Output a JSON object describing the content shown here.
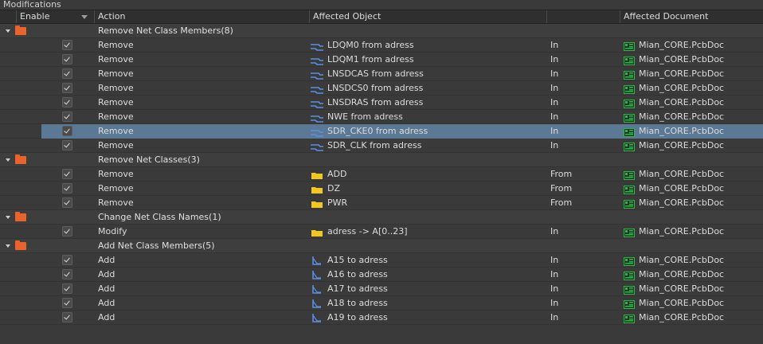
{
  "panel_title": "Modifications",
  "columns": {
    "enable": "Enable",
    "action": "Action",
    "affected_object": "Affected Object",
    "blank": "",
    "affected_document": "Affected Document"
  },
  "groups": [
    {
      "label": "Remove Net Class Members(8)",
      "rows": [
        {
          "action": "Remove",
          "object": "LDQM0 from adress",
          "icon": "net-member-icon",
          "dir": "In",
          "doc": "Mian_CORE.PcbDoc",
          "selected": false
        },
        {
          "action": "Remove",
          "object": "LDQM1 from adress",
          "icon": "net-member-icon",
          "dir": "In",
          "doc": "Mian_CORE.PcbDoc",
          "selected": false
        },
        {
          "action": "Remove",
          "object": "LNSDCAS from adress",
          "icon": "net-member-icon",
          "dir": "In",
          "doc": "Mian_CORE.PcbDoc",
          "selected": false
        },
        {
          "action": "Remove",
          "object": "LNSDCS0 from adress",
          "icon": "net-member-icon",
          "dir": "In",
          "doc": "Mian_CORE.PcbDoc",
          "selected": false
        },
        {
          "action": "Remove",
          "object": "LNSDRAS from adress",
          "icon": "net-member-icon",
          "dir": "In",
          "doc": "Mian_CORE.PcbDoc",
          "selected": false
        },
        {
          "action": "Remove",
          "object": "NWE from adress",
          "icon": "net-member-icon",
          "dir": "In",
          "doc": "Mian_CORE.PcbDoc",
          "selected": false
        },
        {
          "action": "Remove",
          "object": "SDR_CKE0 from adress",
          "icon": "net-member-icon",
          "dir": "In",
          "doc": "Mian_CORE.PcbDoc",
          "selected": true
        },
        {
          "action": "Remove",
          "object": "SDR_CLK from adress",
          "icon": "net-member-icon",
          "dir": "In",
          "doc": "Mian_CORE.PcbDoc",
          "selected": false
        }
      ]
    },
    {
      "label": "Remove Net Classes(3)",
      "rows": [
        {
          "action": "Remove",
          "object": "ADD",
          "icon": "folder-icon",
          "dir": "From",
          "doc": "Mian_CORE.PcbDoc",
          "selected": false
        },
        {
          "action": "Remove",
          "object": "DZ",
          "icon": "folder-icon",
          "dir": "From",
          "doc": "Mian_CORE.PcbDoc",
          "selected": false
        },
        {
          "action": "Remove",
          "object": "PWR",
          "icon": "folder-icon",
          "dir": "From",
          "doc": "Mian_CORE.PcbDoc",
          "selected": false
        }
      ]
    },
    {
      "label": "Change Net Class Names(1)",
      "rows": [
        {
          "action": "Modify",
          "object": "adress -> A[0..23]",
          "icon": "folder-icon",
          "dir": "In",
          "doc": "Mian_CORE.PcbDoc",
          "selected": false
        }
      ]
    },
    {
      "label": "Add Net Class Members(5)",
      "rows": [
        {
          "action": "Add",
          "object": "A15 to adress",
          "icon": "net-add-icon",
          "dir": "In",
          "doc": "Mian_CORE.PcbDoc",
          "selected": false
        },
        {
          "action": "Add",
          "object": "A16 to adress",
          "icon": "net-add-icon",
          "dir": "In",
          "doc": "Mian_CORE.PcbDoc",
          "selected": false
        },
        {
          "action": "Add",
          "object": "A17 to adress",
          "icon": "net-add-icon",
          "dir": "In",
          "doc": "Mian_CORE.PcbDoc",
          "selected": false
        },
        {
          "action": "Add",
          "object": "A18 to adress",
          "icon": "net-add-icon",
          "dir": "In",
          "doc": "Mian_CORE.PcbDoc",
          "selected": false
        },
        {
          "action": "Add",
          "object": "A19 to adress",
          "icon": "net-add-icon",
          "dir": "In",
          "doc": "Mian_CORE.PcbDoc",
          "selected": false
        }
      ]
    }
  ],
  "colors": {
    "selection": "#5b7895",
    "group_folder": "#e8642a",
    "net_icon": "#5b8fe0",
    "class_folder": "#f2c81c",
    "doc_icon": "#2fb44a"
  }
}
